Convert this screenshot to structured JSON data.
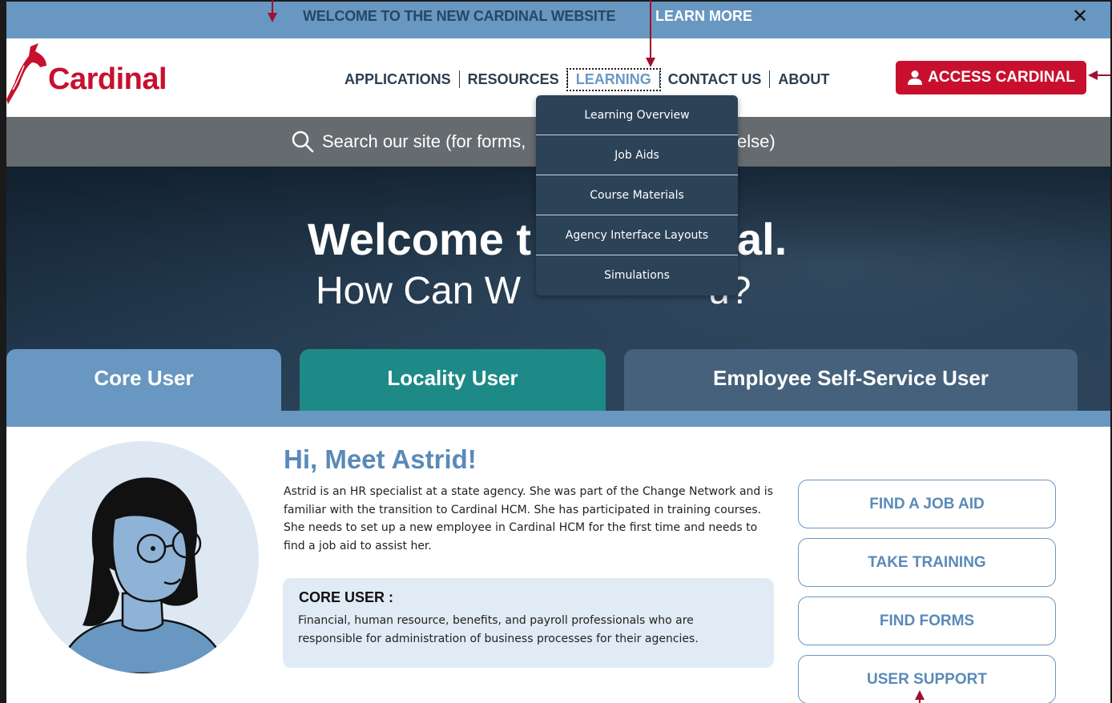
{
  "banner": {
    "text": "WELCOME TO THE NEW CARDINAL WEBSITE",
    "link": "LEARN MORE",
    "close": "✕"
  },
  "header": {
    "logo_text": "Cardinal",
    "nav": [
      {
        "label": "APPLICATIONS"
      },
      {
        "label": "RESOURCES"
      },
      {
        "label": "LEARNING"
      },
      {
        "label": "CONTACT US"
      },
      {
        "label": "ABOUT"
      }
    ],
    "access_button": "ACCESS CARDINAL"
  },
  "search": {
    "text_left": "Search our site (for forms,",
    "text_right": "else)"
  },
  "hero": {
    "title_left": "Welcome t",
    "title_right": "al.",
    "subtitle_left": "How Can W",
    "subtitle_right": "u?"
  },
  "learning_menu": [
    "Learning Overview",
    "Job Aids",
    "Course Materials",
    "Agency Interface Layouts",
    "Simulations"
  ],
  "tabs": {
    "core": "Core User",
    "locality": "Locality User",
    "ess": "Employee Self-Service User"
  },
  "intro": {
    "title": "Hi, Meet Astrid!",
    "body": "Astrid is an HR specialist at a state agency. She was part of the Change Network and is familiar with the transition to Cardinal HCM. She has participated in training courses. She needs to set up a new employee in Cardinal HCM for the first time and needs to find a job aid to assist her."
  },
  "core_box": {
    "title": "CORE USER :",
    "body": "Financial, human resource, benefits, and payroll professionals who are responsible for administration of business processes for their agencies."
  },
  "side_buttons": [
    "FIND A JOB AID",
    "TAKE TRAINING",
    "FIND FORMS",
    "USER SUPPORT"
  ],
  "colors": {
    "brand_red": "#c8102e",
    "banner_blue": "#6897c1",
    "teal": "#1e8a87",
    "slate": "#45617b",
    "menu_bg": "#2c4257"
  }
}
